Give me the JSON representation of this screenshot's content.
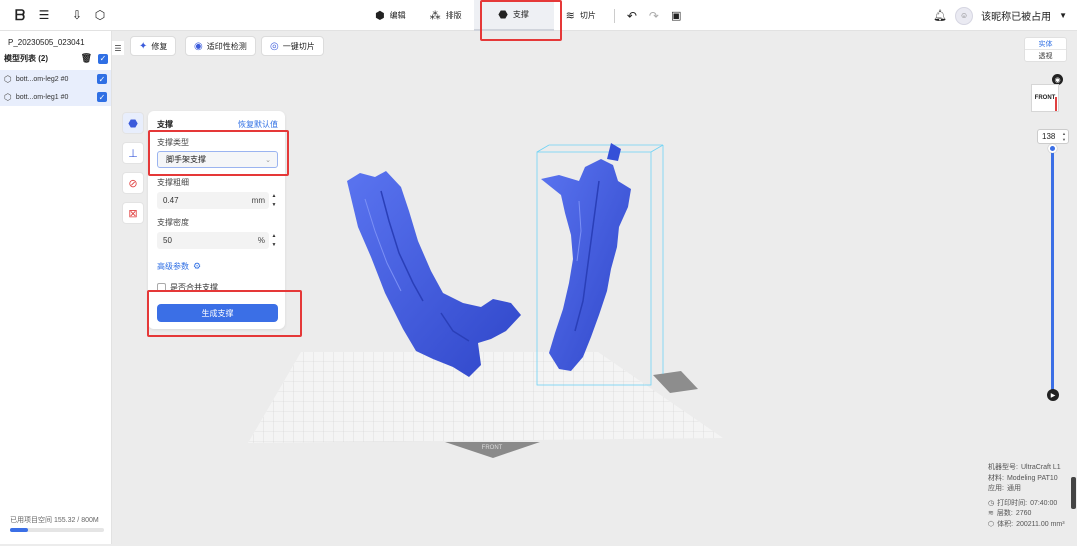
{
  "header": {
    "tabs": [
      {
        "label": "编辑",
        "icon": "edit-icon"
      },
      {
        "label": "排版",
        "icon": "layout-icon"
      },
      {
        "label": "支撑",
        "icon": "support-icon"
      },
      {
        "label": "切片",
        "icon": "slice-icon"
      }
    ],
    "active_tab": "支撑",
    "username": "该昵称已被占用",
    "accent_color": "#3b6fe6",
    "highlight_color": "#e53838"
  },
  "left_panel": {
    "project_name": "P_20230505_023041",
    "model_list_label": "模型列表 (2)",
    "models": [
      {
        "name": "bott...om-leg2 #0",
        "checked": true
      },
      {
        "name": "bott...om-leg1 #0",
        "checked": true
      }
    ],
    "storage_label": "已用项目空间",
    "storage_value": "155.32 / 800M",
    "storage_fraction": 0.194
  },
  "toolbar": {
    "repair_label": "修复",
    "printability_label": "适印性检测",
    "one_click_slice_label": "一键切片"
  },
  "support_panel": {
    "title": "支撑",
    "restore_default": "恢复默认值",
    "support_type_label": "支撑类型",
    "support_type_value": "脚手架支撑",
    "support_thickness_label": "支撑粗细",
    "support_thickness_value": "0.47",
    "support_thickness_unit": "mm",
    "support_density_label": "支撑密度",
    "support_density_value": "50",
    "support_density_unit": "%",
    "advanced_label": "高级参数",
    "merge_label": "是否合并支撑",
    "generate_label": "生成支撑"
  },
  "view": {
    "solid_label": "实体",
    "transparent_label": "透视",
    "cube_face": "FRONT",
    "bed_label": "FRONT",
    "layer_value": "138"
  },
  "machine_info": {
    "model_label": "机器型号:",
    "model_value": "UltraCraft L1",
    "material_label": "材料:",
    "material_value": "Modeling PAT10",
    "use_label": "应用:",
    "use_value": "通用",
    "print_time_label": "打印时间:",
    "print_time_value": "07:40:00",
    "layers_label": "层数:",
    "layers_value": "2760",
    "volume_label": "体积:",
    "volume_value": "200211.00 mm³"
  }
}
